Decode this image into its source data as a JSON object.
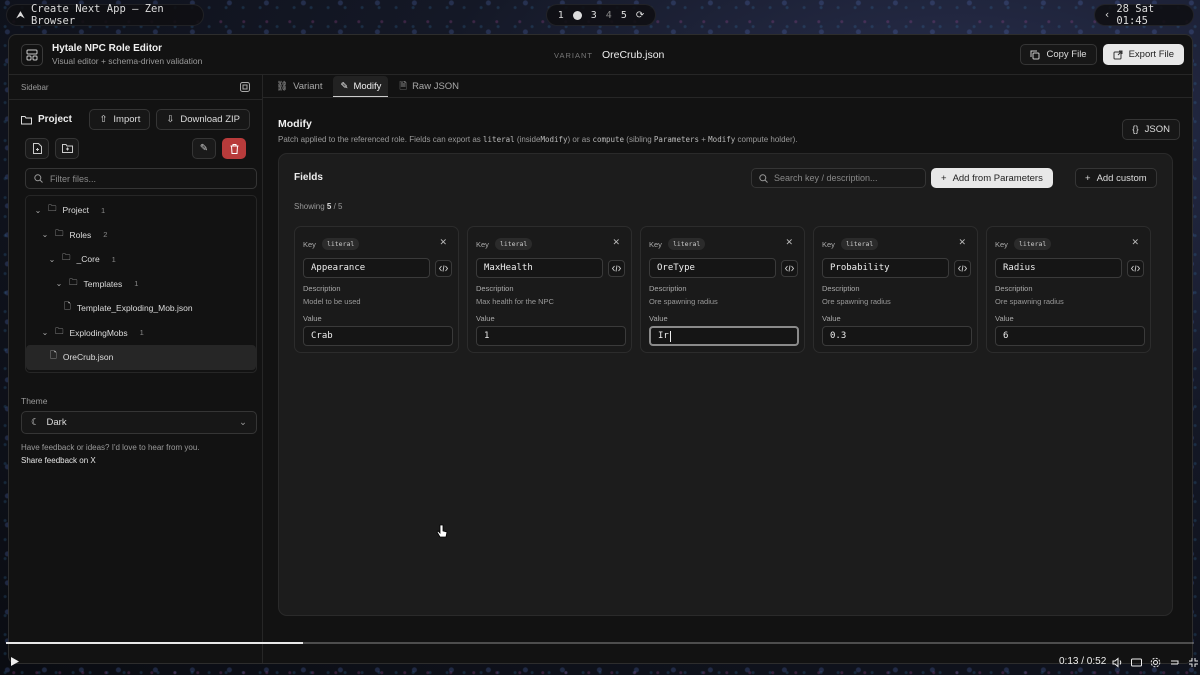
{
  "topbar": {
    "window_title": "Create Next App — Zen Browser",
    "workspaces": [
      "1",
      "3",
      "4",
      "5"
    ],
    "clock": "28 Sat 01:45"
  },
  "app": {
    "title": "Hytale NPC Role Editor",
    "subtitle": "Visual editor + schema-driven validation",
    "variant_label": "VARIANT",
    "variant_file": "OreCrub.json",
    "copy_file": "Copy File",
    "export_file": "Export File"
  },
  "sidebar": {
    "heading": "Sidebar",
    "project_label": "Project",
    "import_label": "Import",
    "download_label": "Download ZIP",
    "filter_placeholder": "Filter files...",
    "tree": [
      {
        "label": "Project",
        "count": "1"
      },
      {
        "label": "Roles",
        "count": "2"
      },
      {
        "label": "_Core",
        "count": "1"
      },
      {
        "label": "Templates",
        "count": "1"
      },
      {
        "label": "Template_Exploding_Mob.json",
        "count": ""
      },
      {
        "label": "ExplodingMobs",
        "count": "1"
      },
      {
        "label": "OreCrub.json",
        "count": ""
      }
    ],
    "theme_label": "Theme",
    "theme_value": "Dark",
    "feedback_text": "Have feedback or ideas? I'd love to hear from you.",
    "feedback_link": "Share feedback on X"
  },
  "tabs": [
    {
      "label": "Variant"
    },
    {
      "label": "Modify"
    },
    {
      "label": "Raw JSON"
    }
  ],
  "modify": {
    "title": "Modify",
    "desc_1": "Patch applied to the referenced role. Fields can export as",
    "desc_code_1": "literal",
    "desc_2": "(inside",
    "desc_code_2": "Modify",
    "desc_3": ") or as",
    "desc_code_3": "compute",
    "desc_4": "(sibling",
    "desc_code_4": "Parameters",
    "desc_5": "+",
    "desc_code_5": "Modify",
    "desc_6": "compute holder).",
    "json_button": "JSON",
    "fields_title": "Fields",
    "showing_prefix": "Showing",
    "showing_count": "5",
    "showing_total": "/ 5",
    "search_placeholder": "Search key / description...",
    "add_from_params": "Add from Parameters",
    "add_custom": "Add custom"
  },
  "fields": [
    {
      "key_label": "Key",
      "mode": "literal",
      "key": "Appearance",
      "desc_label": "Description",
      "description": "Model to be used",
      "value_label": "Value",
      "value": "Crab"
    },
    {
      "key_label": "Key",
      "mode": "literal",
      "key": "MaxHealth",
      "desc_label": "Description",
      "description": "Max health for the NPC",
      "value_label": "Value",
      "value": "1"
    },
    {
      "key_label": "Key",
      "mode": "literal",
      "key": "OreType",
      "desc_label": "Description",
      "description": "Ore spawning radius",
      "value_label": "Value",
      "value": "Ir"
    },
    {
      "key_label": "Key",
      "mode": "literal",
      "key": "Probability",
      "desc_label": "Description",
      "description": "Ore spawning radius",
      "value_label": "Value",
      "value": "0.3"
    },
    {
      "key_label": "Key",
      "mode": "literal",
      "key": "Radius",
      "desc_label": "Description",
      "description": "Ore spawning radius",
      "value_label": "Value",
      "value": "6"
    }
  ],
  "video": {
    "time": "0:13 / 0:52",
    "progress": 0.25
  }
}
